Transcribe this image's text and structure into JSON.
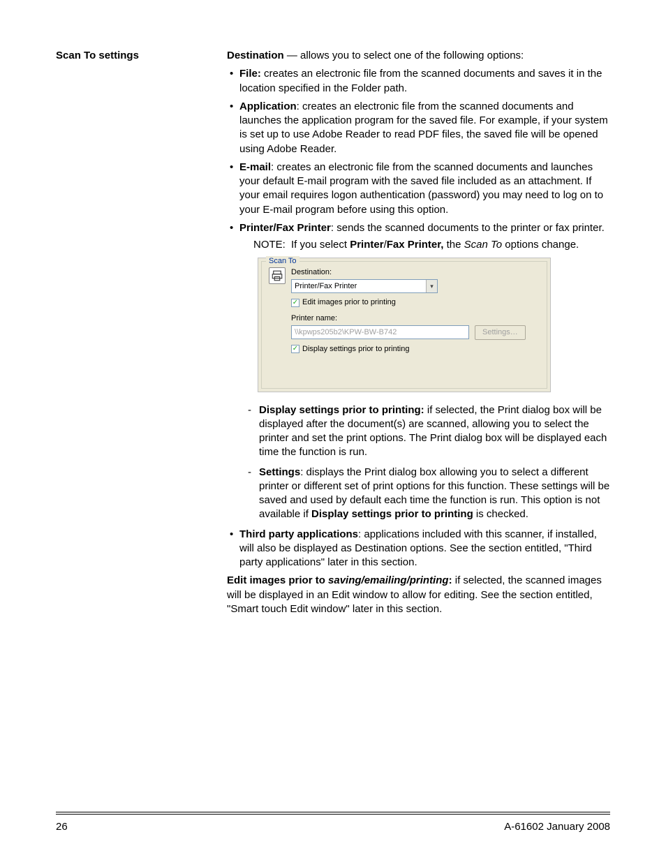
{
  "left_heading": "Scan To settings",
  "intro": {
    "bold": "Destination",
    "rest": " — allows you to select one of the following options:"
  },
  "bullets": {
    "file": {
      "bold": "File:",
      "text": " creates an electronic file from the scanned documents and saves it in the location specified in the Folder path."
    },
    "app": {
      "bold": "Application",
      "text": ": creates an electronic file from the scanned documents and launches the application program for the saved file. For example, if your system is set up to use Adobe Reader to read PDF files, the saved file will be opened using Adobe Reader."
    },
    "email": {
      "bold": "E-mail",
      "text": ": creates an electronic file from the scanned documents and launches your default E-mail program with the saved file included as an attachment. If your email requires logon authentication (password) you may need to log on to your E-mail program before using this option."
    },
    "printer": {
      "bold": "Printer/Fax Printer",
      "text": ": sends the scanned documents to the printer or fax printer."
    }
  },
  "note": {
    "label": "NOTE:",
    "pre": "If you select ",
    "b1": "Printer",
    "sep": "/",
    "b2": "Fax Printer,",
    "post1": " the ",
    "ital": "Scan To",
    "post2": " options change."
  },
  "panel": {
    "legend": "Scan To",
    "dest_label": "Destination:",
    "dest_value": "Printer/Fax Printer",
    "edit_chk": "Edit images prior to printing",
    "printer_label": "Printer name:",
    "printer_value": "\\\\kpwps205b2\\KPW-BW-B742",
    "settings_btn": "Settings…",
    "display_chk": "Display settings prior to printing"
  },
  "dashes": {
    "d1": {
      "bold": "Display settings prior to printing:",
      "text": " if selected, the Print dialog box will be displayed after the document(s) are scanned, allowing you to select the printer and set the print options. The Print dialog box will be displayed each time the function is run."
    },
    "d2": {
      "bold": "Settings",
      "text1": ": displays the Print dialog box allowing you to select a different printer or different set of print options for this function. These settings will be saved and used by default each time the function is run. This option is not available if ",
      "bold2": "Display settings prior to printing",
      "text2": " is checked."
    }
  },
  "third_party": {
    "bold": "Third party applications",
    "text": ": applications included with this scanner, if installed, will also be displayed as Destination options. See the section entitled, \"Third party applications\" later in this section."
  },
  "edit_images": {
    "b1": "Edit images prior to ",
    "ital": "saving/emailing/printing",
    "b2": ":",
    "text": " if selected, the scanned images will be displayed in an Edit window to allow for editing. See the section entitled, \"Smart touch Edit window\" later in this section."
  },
  "footer": {
    "page": "26",
    "doc": "A-61602  January 2008"
  }
}
